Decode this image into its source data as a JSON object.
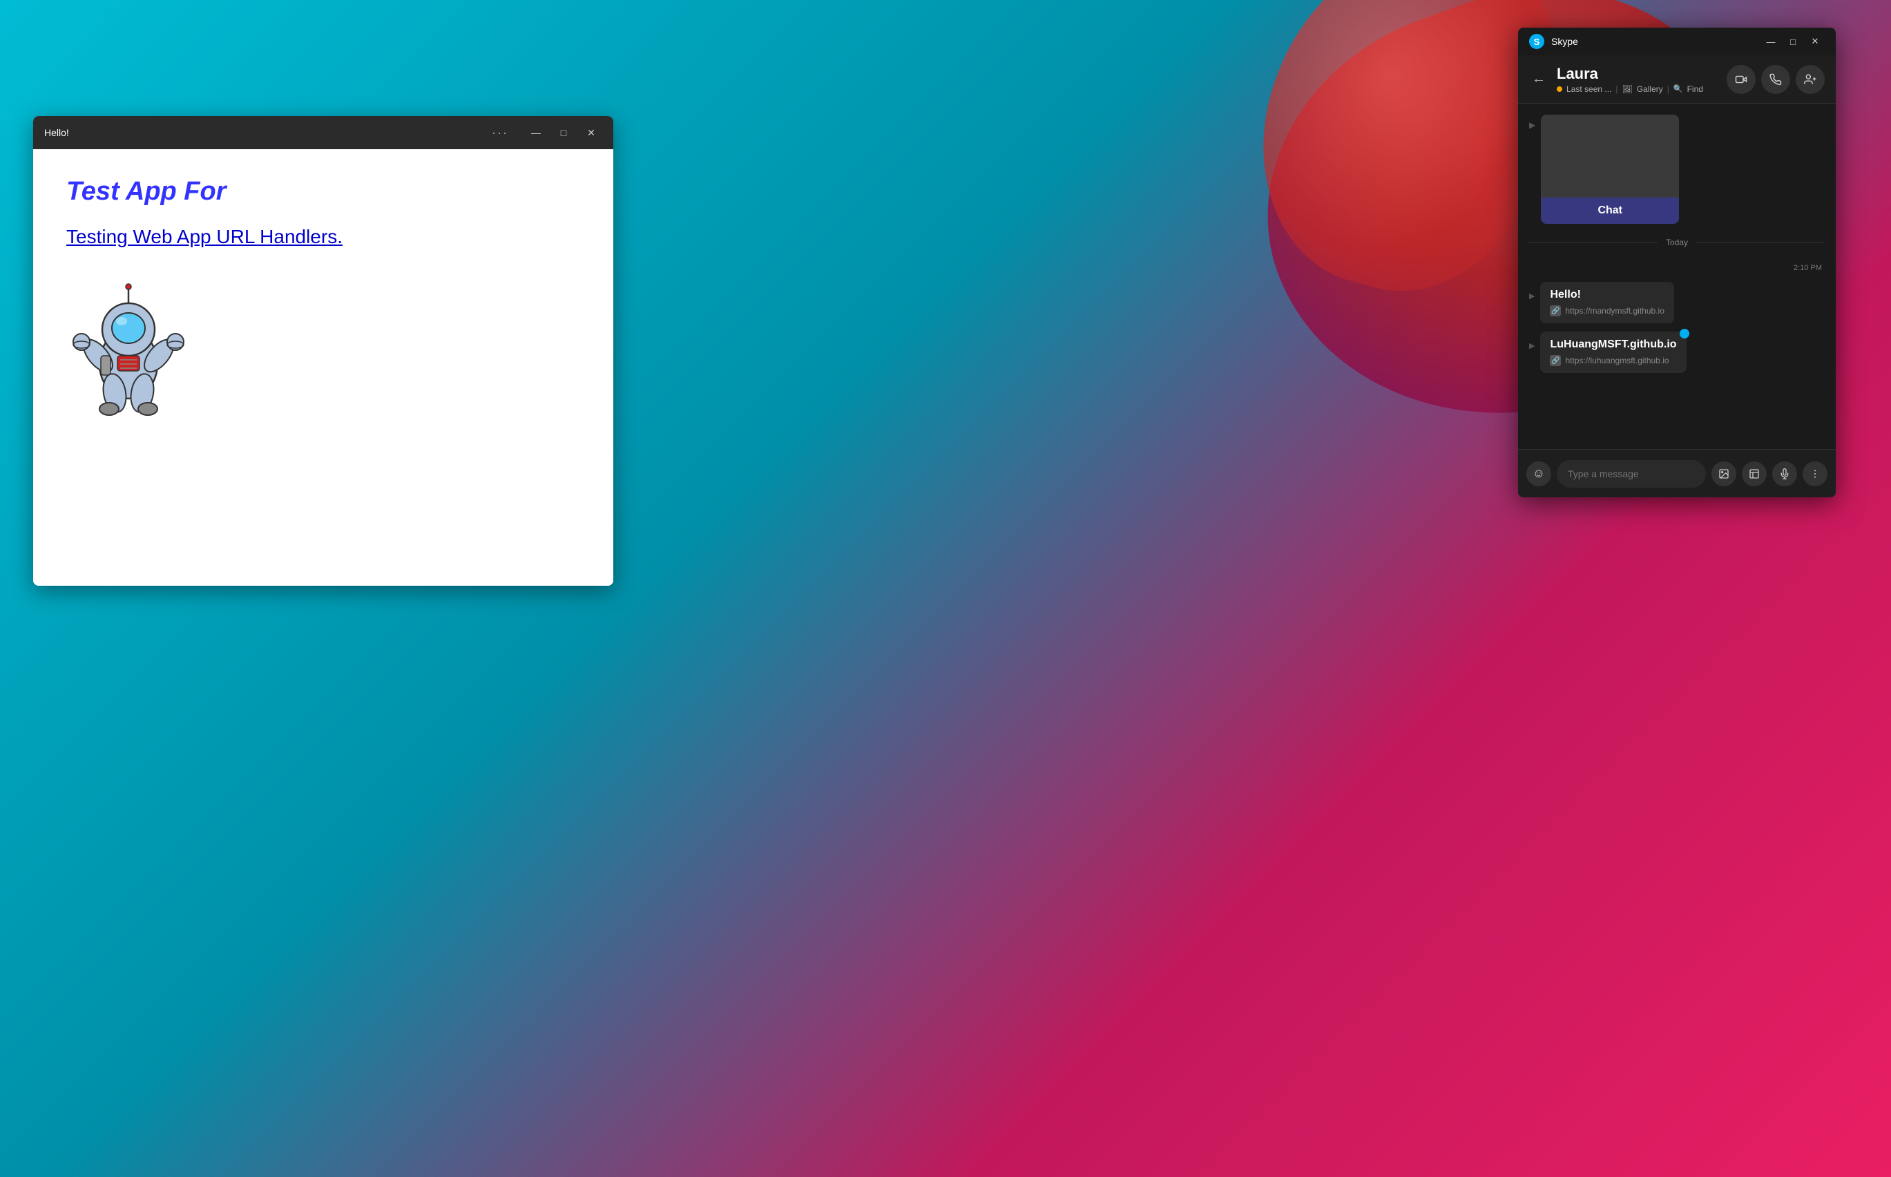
{
  "background": {
    "color": "#00bcd4"
  },
  "webapp": {
    "title": "Hello!",
    "heading": "Test App For",
    "link_text": "Testing Web App URL Handlers",
    "link_suffix": "."
  },
  "skype": {
    "app_name": "Skype",
    "contact_name": "Laura",
    "status_text": "Last seen ...",
    "gallery_label": "Gallery",
    "find_label": "Find",
    "chat_card_label": "Chat",
    "today_label": "Today",
    "timestamp": "2:10 PM",
    "message1_text": "Hello!",
    "message1_link": "https://mandymsft.github.io",
    "message2_text": "LuHuangMSFT.github.io",
    "message2_link": "https://luhuangmsft.github.io",
    "input_placeholder": "Type a message"
  },
  "titlebar": {
    "minimize": "—",
    "maximize": "□",
    "close": "✕",
    "dots": "···"
  }
}
